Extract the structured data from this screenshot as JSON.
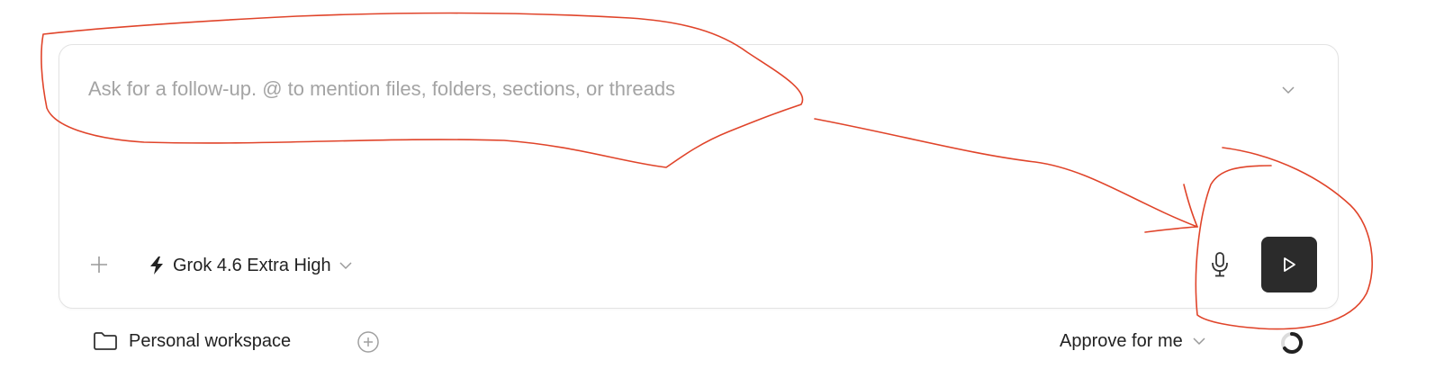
{
  "composer": {
    "placeholder": "Ask for a follow-up. @ to mention files, folders, sections, or threads",
    "value": ""
  },
  "toolbar": {
    "model_label": "Grok 4.6 Extra High",
    "model_icon": "lightning-icon",
    "add_icon": "plus-icon",
    "mic_icon": "microphone-icon",
    "send_icon": "send-icon"
  },
  "footer": {
    "workspace_label": "Personal workspace",
    "approve_label": "Approve for me"
  },
  "colors": {
    "send_button_bg": "#2b2b2b",
    "annotation": "#e0442a",
    "placeholder": "#a4a4a4"
  }
}
